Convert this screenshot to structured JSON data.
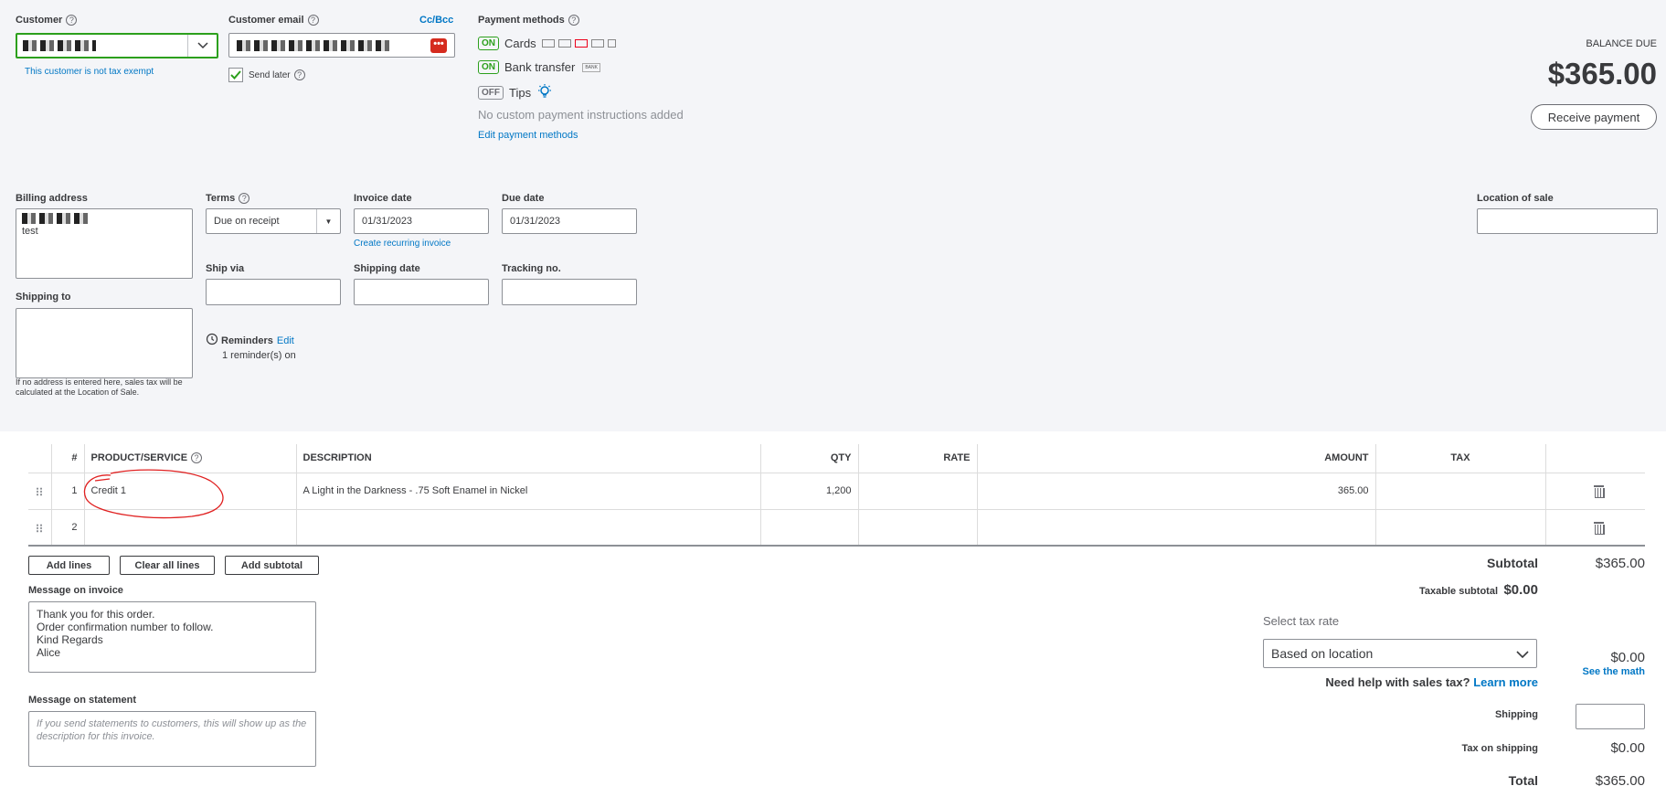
{
  "customer": {
    "label": "Customer",
    "help": "?",
    "tax_exempt_note": "This customer is not tax exempt"
  },
  "email": {
    "label": "Customer email",
    "cc_bcc": "Cc/Bcc",
    "send_later": "Send later"
  },
  "payment": {
    "label": "Payment methods",
    "rows": [
      {
        "toggle": "ON",
        "label": "Cards"
      },
      {
        "toggle": "ON",
        "label": "Bank transfer"
      },
      {
        "toggle": "OFF",
        "label": "Tips"
      }
    ],
    "no_instructions": "No custom payment instructions added",
    "edit_link": "Edit payment methods",
    "bank_badge": "BANK"
  },
  "balance": {
    "label": "BALANCE DUE",
    "amount": "$365.00",
    "receive_button": "Receive payment"
  },
  "billing": {
    "label": "Billing address",
    "line2": "test"
  },
  "shipping_to": {
    "label": "Shipping to",
    "note": "If no address is entered here, sales tax will be calculated at the Location of Sale."
  },
  "terms": {
    "label": "Terms",
    "value": "Due on receipt"
  },
  "invoice_date": {
    "label": "Invoice date",
    "value": "01/31/2023",
    "recurring_link": "Create recurring invoice"
  },
  "due_date": {
    "label": "Due date",
    "value": "01/31/2023"
  },
  "ship_via": {
    "label": "Ship via"
  },
  "shipping_date": {
    "label": "Shipping date"
  },
  "tracking": {
    "label": "Tracking no."
  },
  "reminders": {
    "label": "Reminders",
    "edit": "Edit",
    "status": "1 reminder(s) on"
  },
  "location_of_sale": {
    "label": "Location of sale"
  },
  "table": {
    "headers": {
      "num": "#",
      "product": "PRODUCT/SERVICE",
      "description": "DESCRIPTION",
      "qty": "QTY",
      "rate": "RATE",
      "amount": "AMOUNT",
      "tax": "TAX"
    },
    "rows": [
      {
        "num": "1",
        "product": "Credit 1",
        "description": "A Light in the Darkness - .75 Soft Enamel in Nickel",
        "qty": "1,200",
        "rate": "",
        "amount": "365.00",
        "tax": ""
      },
      {
        "num": "2",
        "product": "",
        "description": "",
        "qty": "",
        "rate": "",
        "amount": "",
        "tax": ""
      }
    ]
  },
  "line_buttons": {
    "add_lines": "Add lines",
    "clear_all": "Clear all lines",
    "add_subtotal": "Add subtotal"
  },
  "message_invoice": {
    "label": "Message on invoice",
    "text": "Thank you for this order.\nOrder confirmation number to follow.\nKind Regards\nAlice"
  },
  "message_statement": {
    "label": "Message on statement",
    "placeholder": "If you send statements to customers, this will show up as the description for this invoice."
  },
  "totals": {
    "subtotal_label": "Subtotal",
    "subtotal_value": "$365.00",
    "taxable_label": "Taxable subtotal",
    "taxable_value": "$0.00",
    "select_tax_label": "Select tax rate",
    "tax_rate_value": "Based on location",
    "tax_value": "$0.00",
    "see_math": "See the math",
    "help_text": "Need help with sales tax?",
    "learn_more": "Learn more",
    "shipping_label": "Shipping",
    "tax_on_shipping_label": "Tax on shipping",
    "tax_on_shipping_value": "$0.00",
    "total_label": "Total",
    "total_value": "$365.00"
  }
}
